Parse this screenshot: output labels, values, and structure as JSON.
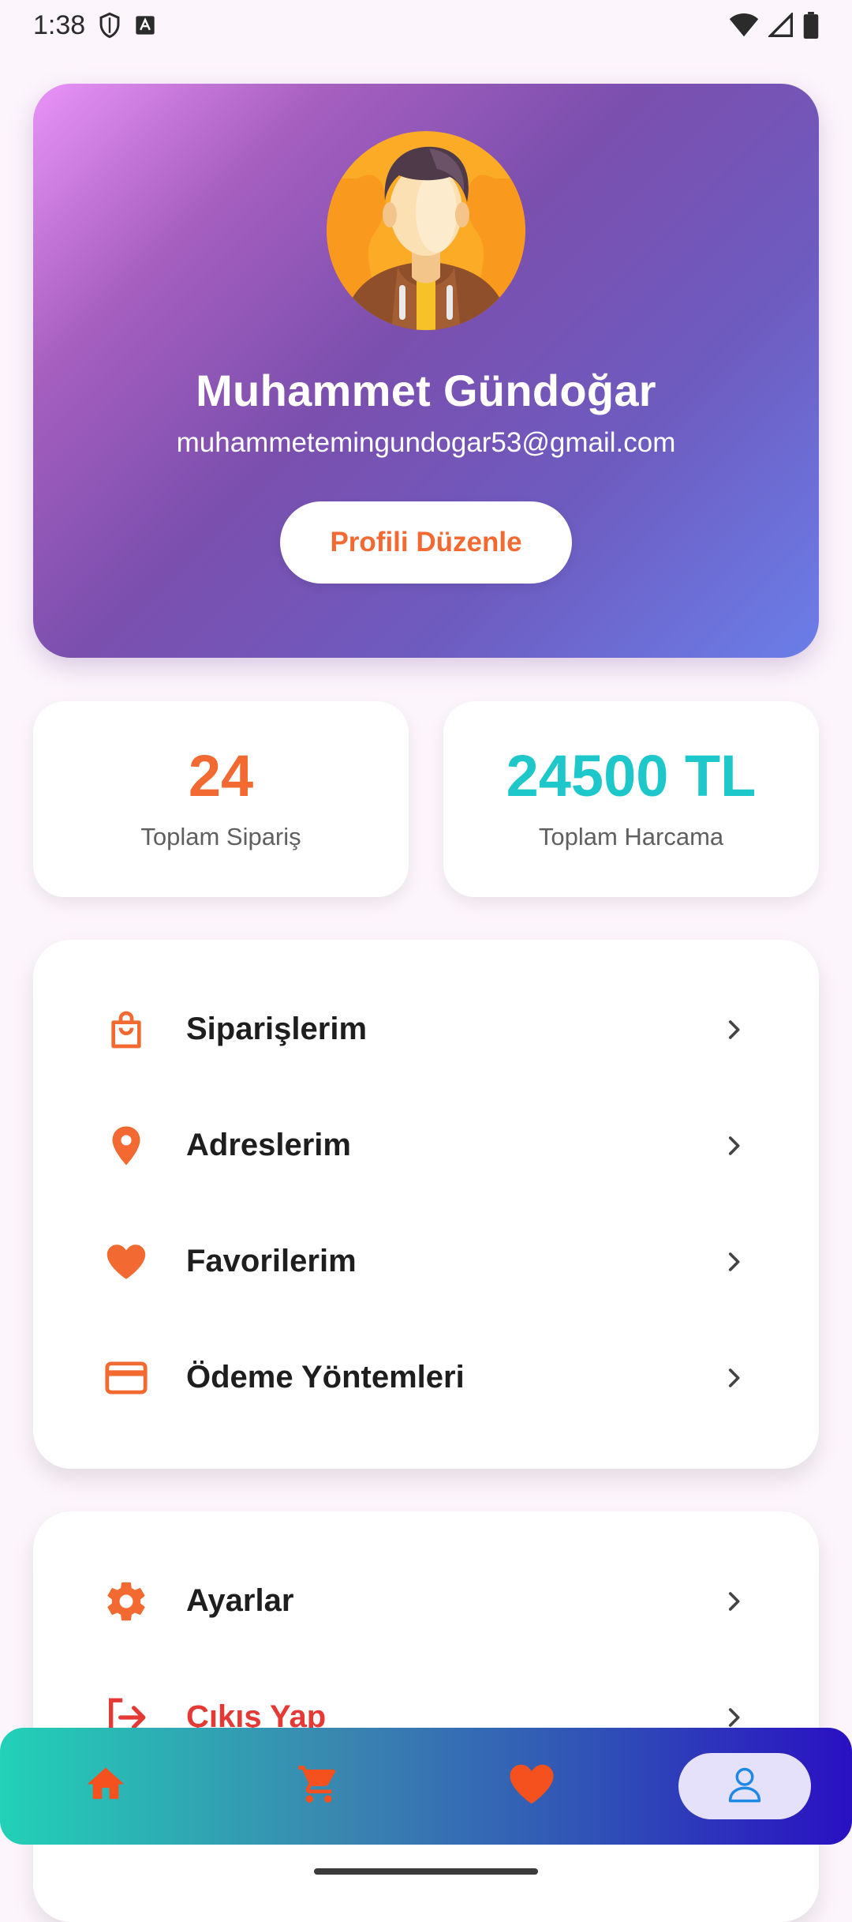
{
  "status_bar": {
    "time": "1:38"
  },
  "profile": {
    "name": "Muhammet Gündoğar",
    "email": "muhammetemingundogar53@gmail.com",
    "edit_label": "Profili Düzenle"
  },
  "stats": [
    {
      "value": "24",
      "label": "Toplam Sipariş",
      "color": "#f26a31"
    },
    {
      "value": "24500 TL",
      "label": "Toplam Harcama",
      "color": "#1ec7c9"
    }
  ],
  "menu": {
    "items": [
      {
        "label": "Siparişlerim",
        "icon": "shopping-bag-icon"
      },
      {
        "label": "Adreslerim",
        "icon": "location-pin-icon"
      },
      {
        "label": "Favorilerim",
        "icon": "heart-icon"
      },
      {
        "label": "Ödeme Yöntemleri",
        "icon": "credit-card-icon"
      }
    ]
  },
  "menu_secondary": {
    "items": [
      {
        "label": "Ayarlar",
        "icon": "gear-icon"
      },
      {
        "label": "Çıkış Yap",
        "icon": "logout-icon"
      }
    ]
  },
  "bottom_nav": {
    "items": [
      {
        "icon": "home-icon"
      },
      {
        "icon": "cart-icon"
      },
      {
        "icon": "heart-icon"
      },
      {
        "icon": "person-icon",
        "active": true
      }
    ]
  },
  "colors": {
    "accent": "#f26a31",
    "teal": "#1ec7c9",
    "danger": "#e53935"
  }
}
